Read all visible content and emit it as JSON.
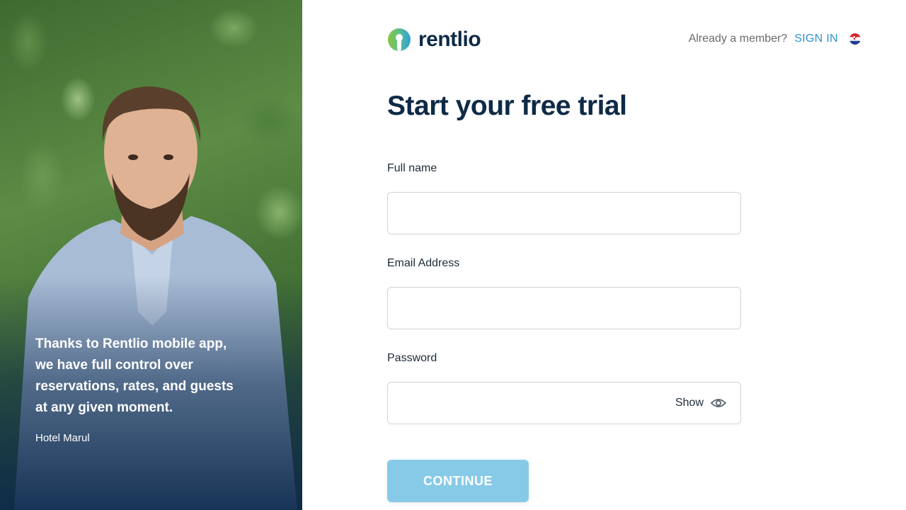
{
  "testimonial": {
    "quote": "Thanks to Rentlio mobile app, we have full control over reservations, rates, and guests at any given moment.",
    "author": "Hotel Marul"
  },
  "header": {
    "brand": "rentlio",
    "member_prompt": "Already a member?",
    "sign_in": "SIGN IN",
    "language_flag": "croatia-flag-icon"
  },
  "form": {
    "title": "Start your free trial",
    "full_name": {
      "label": "Full name",
      "value": "",
      "placeholder": ""
    },
    "email": {
      "label": "Email Address",
      "value": "",
      "placeholder": ""
    },
    "password": {
      "label": "Password",
      "value": "",
      "placeholder": "",
      "toggle_label": "Show"
    },
    "submit": "CONTINUE"
  },
  "colors": {
    "brand_dark": "#0e2a47",
    "link_blue": "#2f95d0",
    "button_light_blue": "#87cae8"
  }
}
